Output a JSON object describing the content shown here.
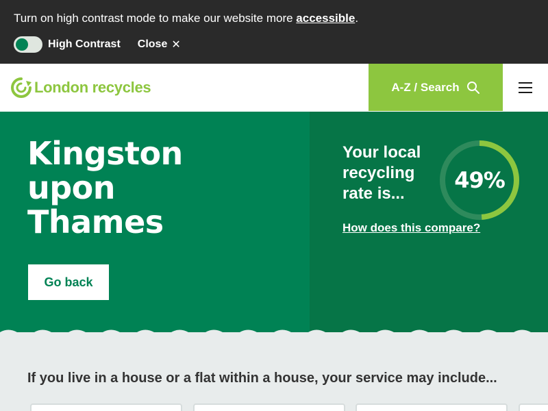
{
  "a11y_banner": {
    "text_before": "Turn on high contrast mode to make our website more ",
    "link": "accessible",
    "text_after": ".",
    "toggle_label": "High Contrast",
    "toggle_state": "off",
    "close_label": "Close",
    "close_icon": "close-icon"
  },
  "header": {
    "logo_text": "London recycles",
    "logo_icon": "recycle-loop-icon",
    "search_label": "A-Z / Search",
    "search_icon": "search-icon",
    "menu_icon": "hamburger-menu-icon"
  },
  "hero": {
    "title_lines": [
      "Kingston",
      "upon",
      "Thames"
    ],
    "go_back_label": "Go back",
    "rate_label": "Your local recycling rate is...",
    "rate_value": "49%",
    "rate_fraction": 0.49,
    "compare_link": "How does this compare?"
  },
  "services": {
    "heading": "If you live in a house or a flat within a house, your service may include..."
  },
  "colors": {
    "brand_green": "#008254",
    "dark_green": "#067547",
    "light_green": "#8dc63f",
    "banner_bg": "#2a2a2a",
    "section_bg": "#e8ecec"
  }
}
